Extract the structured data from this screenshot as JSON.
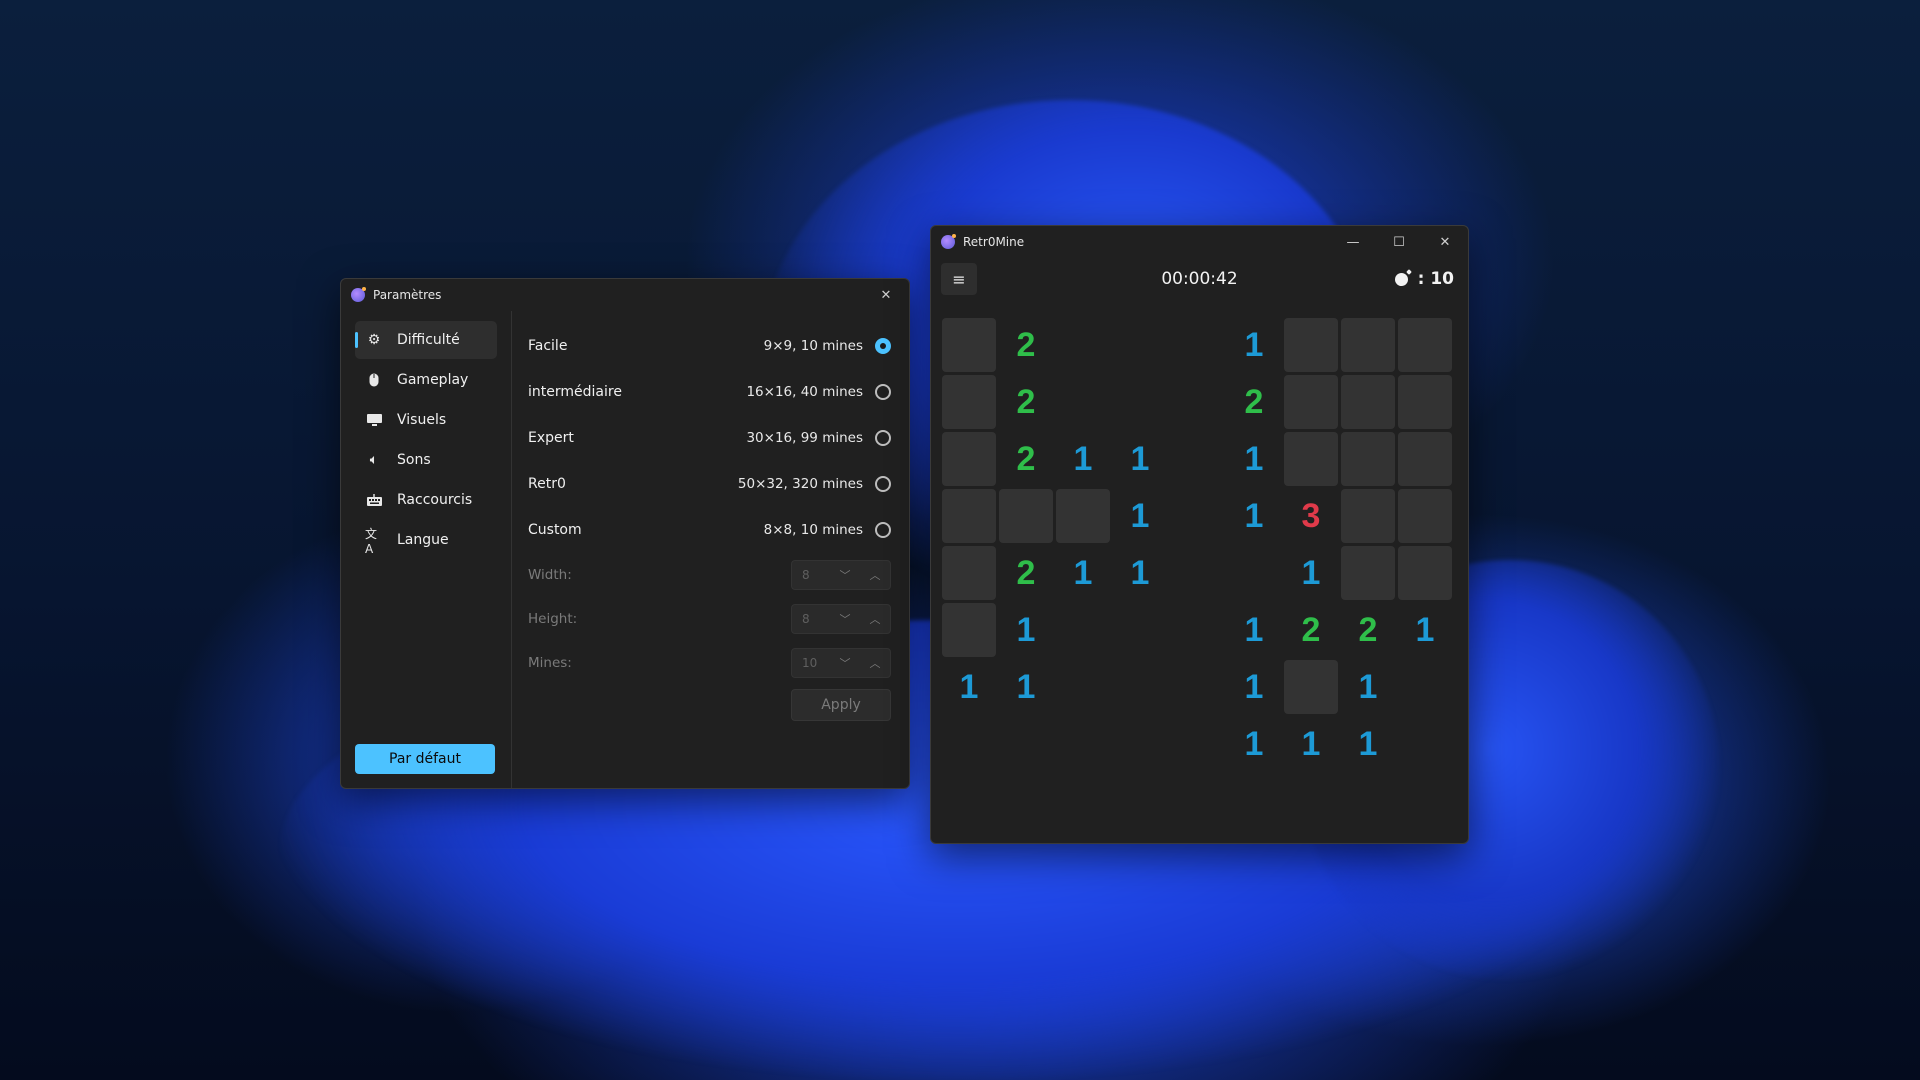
{
  "settings_window": {
    "title": "Paramètres",
    "close_label": "✕",
    "nav": [
      {
        "label": "Difficulté",
        "icon": "gear-icon",
        "active": true
      },
      {
        "label": "Gameplay",
        "icon": "mouse-icon",
        "active": false
      },
      {
        "label": "Visuels",
        "icon": "monitor-icon",
        "active": false
      },
      {
        "label": "Sons",
        "icon": "speaker-icon",
        "active": false
      },
      {
        "label": "Raccourcis",
        "icon": "keyboard-icon",
        "active": false
      },
      {
        "label": "Langue",
        "icon": "translate-icon",
        "active": false
      }
    ],
    "default_button": "Par défaut",
    "difficulties": [
      {
        "name": "Facile",
        "desc": "9×9, 10 mines",
        "selected": true
      },
      {
        "name": "intermédiaire",
        "desc": "16×16, 40 mines",
        "selected": false
      },
      {
        "name": "Expert",
        "desc": "30×16, 99 mines",
        "selected": false
      },
      {
        "name": "Retr0",
        "desc": "50×32, 320 mines",
        "selected": false
      },
      {
        "name": "Custom",
        "desc": "8×8, 10 mines",
        "selected": false
      }
    ],
    "custom_fields": [
      {
        "label": "Width:",
        "value": "8"
      },
      {
        "label": "Height:",
        "value": "8"
      },
      {
        "label": "Mines:",
        "value": "10"
      }
    ],
    "apply_label": "Apply"
  },
  "game_window": {
    "title": "Retr0Mine",
    "minimize_label": "—",
    "maximize_label": "☐",
    "close_label": "✕",
    "menu_label": "≡",
    "timer": "00:00:42",
    "mine_counter": ": 10",
    "colors": {
      "one": "#1d9ad6",
      "two": "#2fbe4a",
      "three": "#e03a4a"
    },
    "board": [
      [
        "#",
        "2",
        "",
        "",
        "",
        "1",
        "#",
        "#",
        "#"
      ],
      [
        "#",
        "2",
        "",
        "",
        "",
        "2",
        "#",
        "#",
        "#"
      ],
      [
        "#",
        "2",
        "1",
        "1",
        "",
        "1",
        "#",
        "#",
        "#"
      ],
      [
        "#",
        "#",
        "#",
        "1",
        "",
        "1",
        "3",
        "#",
        "#"
      ],
      [
        "#",
        "2",
        "1",
        "1",
        "",
        "",
        "1",
        "#",
        "#"
      ],
      [
        "#",
        "1",
        "",
        "",
        "",
        "1",
        "2",
        "2",
        "1"
      ],
      [
        "1",
        "1",
        "",
        "",
        "",
        "1",
        "#",
        "1",
        ""
      ],
      [
        "",
        "",
        "",
        "",
        "",
        "1",
        "1",
        "1",
        ""
      ]
    ]
  }
}
